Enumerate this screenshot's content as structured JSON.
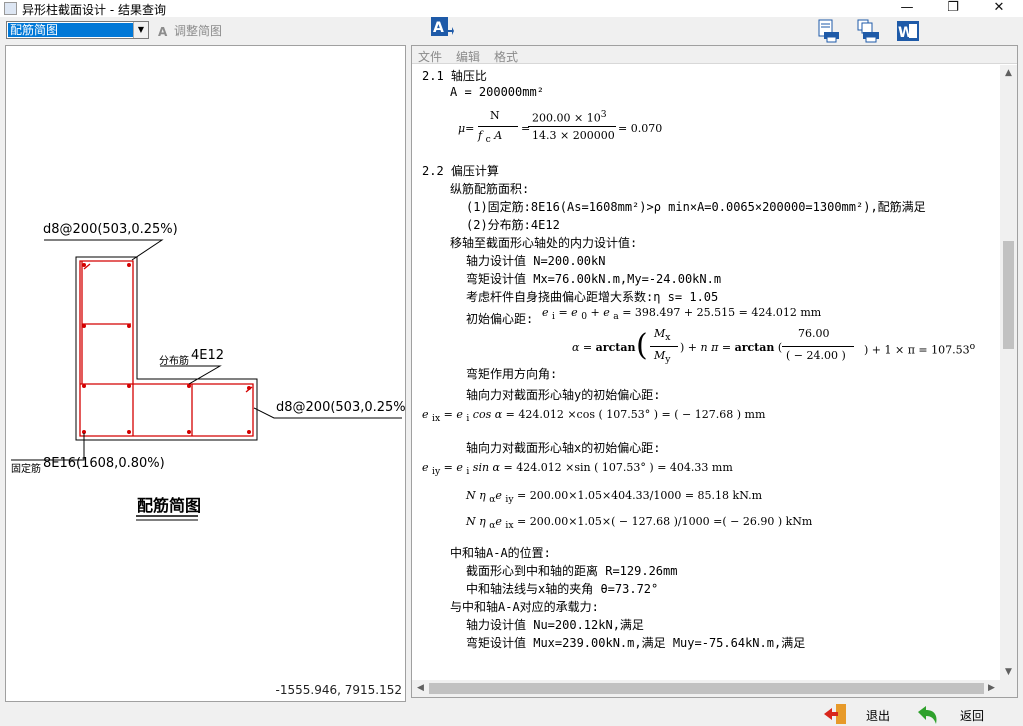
{
  "window": {
    "title": "异形柱截面设计 - 结果查询",
    "min": "—",
    "max": "❐",
    "close": "✕"
  },
  "toolbar": {
    "view_select": "配筋简图",
    "adjust_label": "调整简图"
  },
  "drawing": {
    "label_top": "d8@200(503,0.25%)",
    "label_right": "d8@200(503,0.25%)",
    "label_fenbu": "分布筋",
    "label_fenbu_val": "4E12",
    "label_guding": "固定筋",
    "label_guding_val": "8E16(1608,0.80%)",
    "caption": "配筋简图",
    "coords": "-1555.946,  7915.152"
  },
  "menu": {
    "file": "文件",
    "edit": "编辑",
    "format": "格式"
  },
  "report": {
    "s21": "2.1 轴压比",
    "area": "A = 200000mm²",
    "mu_num": "N",
    "mu_den": "A",
    "mu_val_num": "200.00 × 10",
    "mu_val_exp": "3",
    "mu_val_den": "14.3 × 200000",
    "mu_result": "= 0.070",
    "s22": "2.2 偏压计算",
    "zj": "纵筋配筋面积:",
    "zj1": "(1)固定筋:8E16(As=1608mm²)>ρ min×A=0.0065×200000=1300mm²),配筋满足",
    "zj2": "(2)分布筋:4E12",
    "yz": "移轴至截面形心轴处的内力设计值:",
    "N": "轴力设计值 N=200.00kN",
    "M": "弯矩设计值 Mx=76.00kN.m,My=-24.00kN.m",
    "eta": "考虑杆件自身挠曲偏心距增大系数:η s= 1.05",
    "ei_label": "初始偏心距:",
    "ei_eq": "= 398.497 + 25.515 = 424.012 mm",
    "alpha_label": "弯矩作用方向角:",
    "alpha_mid": ") + n  π = arctan (",
    "alpha_76": "76.00",
    "alpha_24": "( − 24.00 )",
    "alpha_end": ") + 1 × π = 107.53",
    "eix_label": "轴向力对截面形心轴y的初始偏心距:",
    "eix_eq": "= 424.012 ×cos (  107.53° ) = (  − 127.68  ) mm",
    "eiy_label": "轴向力对截面形心轴x的初始偏心距:",
    "eiy_eq": "= 424.012 ×sin (  107.53° ) = 404.33 mm",
    "n1": "= 200.00×1.05×404.33/1000   = 85.18 kN.m",
    "n2": "= 200.00×1.05×(  − 127.68  )/1000   =(  − 26.90  ) kNm",
    "zh": "中和轴A-A的位置:",
    "R": "截面形心到中和轴的距离 R=129.26mm",
    "theta": "中和轴法线与x轴的夹角  θ=73.72°",
    "cz": "与中和轴A-A对应的承载力:",
    "Nu": "轴力设计值 Nu=200.12kN,满足",
    "Mu": "弯矩设计值 Mux=239.00kN.m,满足  Muy=-75.64kN.m,满足"
  },
  "bottom": {
    "exit": "退出",
    "back": "返回"
  },
  "colors": {
    "rebar": "#d40000",
    "accent": "#0078d7"
  }
}
